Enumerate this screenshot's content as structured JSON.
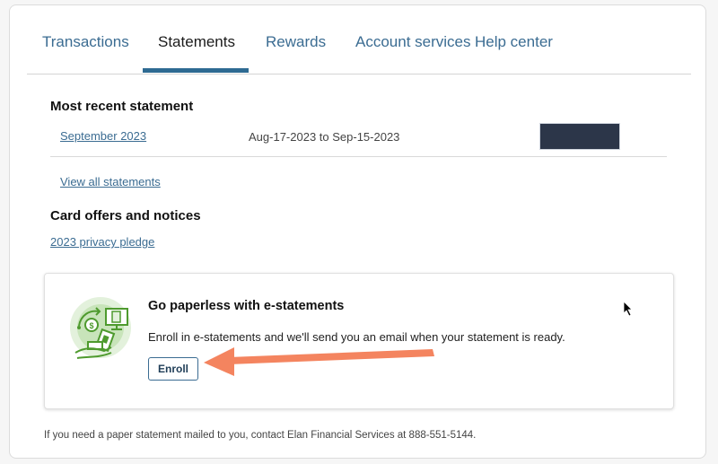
{
  "tabs": [
    {
      "label": "Transactions",
      "active": false
    },
    {
      "label": "Statements",
      "active": true
    },
    {
      "label": "Rewards",
      "active": false
    },
    {
      "label": "Account services",
      "active": false
    },
    {
      "label": "Help center",
      "active": false
    }
  ],
  "most_recent": {
    "heading": "Most recent statement",
    "statement_link": "September 2023",
    "date_range": "Aug-17-2023 to Sep-15-2023",
    "balance": "[redacted]",
    "view_all_link": "View all statements"
  },
  "offers": {
    "heading": "Card offers and notices",
    "privacy_link": "2023 privacy pledge"
  },
  "promo": {
    "icon": "e-statement-illustration-icon",
    "title": "Go paperless with e-statements",
    "description": "Enroll in e-statements and we'll send you an email when your statement is ready.",
    "enroll_label": "Enroll"
  },
  "footer": {
    "note": "If you need a paper statement mailed to you, contact Elan Financial Services at 888-551-5144."
  },
  "colors": {
    "link": "#3b6c92",
    "active_tab_underline": "#2e6a92",
    "annotation_arrow": "#f4845f",
    "redaction": "#2c3649",
    "illustration_green": "#4e9a2e"
  }
}
